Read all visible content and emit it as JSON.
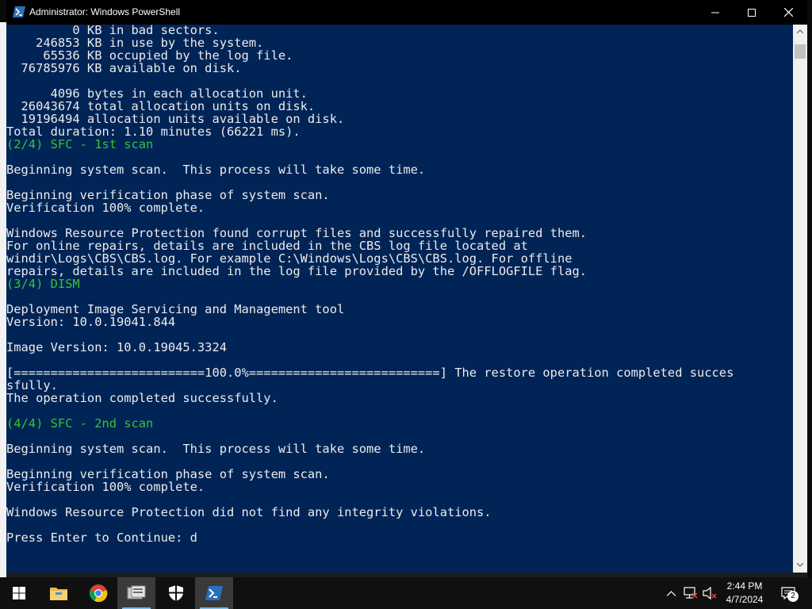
{
  "window": {
    "title": "Administrator: Windows PowerShell",
    "minimize_icon": "minimize-icon",
    "maximize_icon": "maximize-icon",
    "close_icon": "close-icon"
  },
  "console": {
    "lines": [
      {
        "text": "         0 KB in bad sectors.",
        "color": "default"
      },
      {
        "text": "    246853 KB in use by the system.",
        "color": "default"
      },
      {
        "text": "     65536 KB occupied by the log file.",
        "color": "default"
      },
      {
        "text": "  76785976 KB available on disk.",
        "color": "default"
      },
      {
        "text": "",
        "color": "default"
      },
      {
        "text": "      4096 bytes in each allocation unit.",
        "color": "default"
      },
      {
        "text": "  26043674 total allocation units on disk.",
        "color": "default"
      },
      {
        "text": "  19196494 allocation units available on disk.",
        "color": "default"
      },
      {
        "text": "Total duration: 1.10 minutes (66221 ms).",
        "color": "default"
      },
      {
        "text": "(2/4) SFC - 1st scan",
        "color": "green"
      },
      {
        "text": "",
        "color": "default"
      },
      {
        "text": "Beginning system scan.  This process will take some time.",
        "color": "default"
      },
      {
        "text": "",
        "color": "default"
      },
      {
        "text": "Beginning verification phase of system scan.",
        "color": "default"
      },
      {
        "text": "Verification 100% complete.",
        "color": "default"
      },
      {
        "text": "",
        "color": "default"
      },
      {
        "text": "Windows Resource Protection found corrupt files and successfully repaired them.",
        "color": "default"
      },
      {
        "text": "For online repairs, details are included in the CBS log file located at",
        "color": "default"
      },
      {
        "text": "windir\\Logs\\CBS\\CBS.log. For example C:\\Windows\\Logs\\CBS\\CBS.log. For offline",
        "color": "default"
      },
      {
        "text": "repairs, details are included in the log file provided by the /OFFLOGFILE flag.",
        "color": "default"
      },
      {
        "text": "(3/4) DISM",
        "color": "green"
      },
      {
        "text": "",
        "color": "default"
      },
      {
        "text": "Deployment Image Servicing and Management tool",
        "color": "default"
      },
      {
        "text": "Version: 10.0.19041.844",
        "color": "default"
      },
      {
        "text": "",
        "color": "default"
      },
      {
        "text": "Image Version: 10.0.19045.3324",
        "color": "default"
      },
      {
        "text": "",
        "color": "default"
      },
      {
        "text": "[==========================100.0%==========================] The restore operation completed succes",
        "color": "default"
      },
      {
        "text": "sfully.",
        "color": "default"
      },
      {
        "text": "The operation completed successfully.",
        "color": "default"
      },
      {
        "text": "",
        "color": "default"
      },
      {
        "text": "(4/4) SFC - 2nd scan",
        "color": "green"
      },
      {
        "text": "",
        "color": "default"
      },
      {
        "text": "Beginning system scan.  This process will take some time.",
        "color": "default"
      },
      {
        "text": "",
        "color": "default"
      },
      {
        "text": "Beginning verification phase of system scan.",
        "color": "default"
      },
      {
        "text": "Verification 100% complete.",
        "color": "default"
      },
      {
        "text": "",
        "color": "default"
      },
      {
        "text": "Windows Resource Protection did not find any integrity violations.",
        "color": "default"
      },
      {
        "text": "",
        "color": "default"
      },
      {
        "text": "Press Enter to Continue: d",
        "color": "default"
      }
    ]
  },
  "taskbar": {
    "start_icon": "windows-start-icon",
    "apps": [
      {
        "name": "file-explorer-icon",
        "running": false
      },
      {
        "name": "chrome-icon",
        "running": false
      },
      {
        "name": "server-manager-icon",
        "running": true
      },
      {
        "name": "shield-security-icon",
        "running": false
      },
      {
        "name": "powershell-icon",
        "running": true,
        "active": true
      }
    ],
    "tray": {
      "icons": [
        "chevron-up-icon",
        "network-icon",
        "volume-muted-icon"
      ],
      "time": "2:44 PM",
      "date": "4/7/2024",
      "notifications_count": "2"
    }
  },
  "colors": {
    "console_bg": "#012456",
    "console_fg": "#ececec",
    "highlight_green": "#35c335",
    "taskbar_bg": "#101010"
  }
}
